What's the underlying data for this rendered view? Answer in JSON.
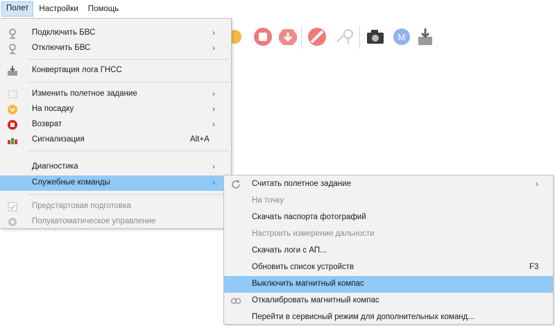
{
  "menubar": {
    "items": [
      "Полет",
      "Настройки",
      "Помощь"
    ]
  },
  "toolbar": {
    "icons": [
      "orange-circle-icon",
      "stop-icon",
      "red-arrow-down-icon",
      "no-fly-icon",
      "waypoint-pin-icon",
      "camera-icon",
      "m-badge-icon",
      "download-box-icon"
    ]
  },
  "menu": {
    "items": [
      {
        "label": "Подключить БВС",
        "arrow": "›"
      },
      {
        "label": "Отключить БВС",
        "arrow": "›"
      },
      {
        "label": "Конвертация лога ГНСС"
      },
      {
        "label": "Изменить полетное задание",
        "arrow": "›"
      },
      {
        "label": "На посадку",
        "arrow": "›"
      },
      {
        "label": "Возврат",
        "arrow": "›"
      },
      {
        "label": "Сигнализация",
        "shortcut": "Alt+A"
      },
      {
        "label": "Диагностика",
        "arrow": "›"
      },
      {
        "label": "Служебные команды",
        "arrow": "›"
      },
      {
        "label": "Предстартовая подготовка"
      },
      {
        "label": "Полуавтоматическое управление"
      }
    ]
  },
  "submenu": {
    "items": [
      {
        "label": "Считать полетное задание",
        "arrow": "›"
      },
      {
        "label": "На точку"
      },
      {
        "label": "Скачать паспорта фотографий"
      },
      {
        "label": "Настроить измерение дальности"
      },
      {
        "label": "Скачать логи с АП..."
      },
      {
        "label": "Обновить список устройств",
        "shortcut": "F3"
      },
      {
        "label": "Выключить магнитный компас"
      },
      {
        "label": "Откалибровать магнитный компас"
      },
      {
        "label": "Перейти в сервисный режим для дополнительных команд..."
      }
    ]
  },
  "colors": {
    "highlight": "#91c9f7",
    "menu_bg": "#f2f2f2",
    "menubar_active": "#cfe6f7"
  }
}
